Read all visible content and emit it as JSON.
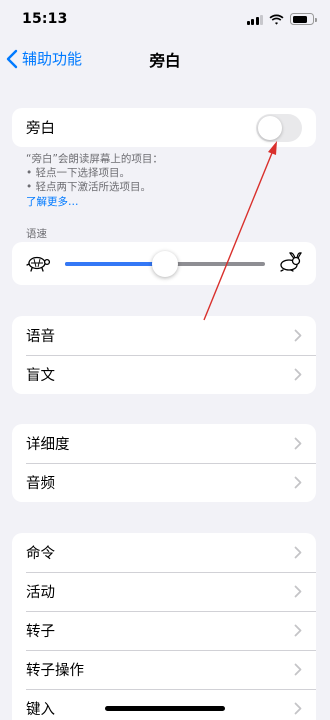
{
  "status_bar": {
    "time": "15:13"
  },
  "nav": {
    "back_label": "辅助功能",
    "title": "旁白"
  },
  "voiceover": {
    "label": "旁白",
    "enabled": false,
    "description": [
      "“旁白”会朗读屏幕上的项目：",
      "• 轻点一下选择项目。",
      "• 轻点两下激活所选项目。"
    ],
    "learn_more": "了解更多…"
  },
  "speaking_rate": {
    "section_label": "语速",
    "value": 0.5
  },
  "group_speech": [
    {
      "label": "语音"
    },
    {
      "label": "盲文"
    }
  ],
  "group_verbosity": [
    {
      "label": "详细度"
    },
    {
      "label": "音频"
    }
  ],
  "group_commands": [
    {
      "label": "命令"
    },
    {
      "label": "活动"
    },
    {
      "label": "转子"
    },
    {
      "label": "转子操作"
    },
    {
      "label": "键入"
    }
  ],
  "colors": {
    "accent": "#007aff",
    "slider_fill": "#3478f6",
    "annotation_arrow": "#d9302c"
  }
}
